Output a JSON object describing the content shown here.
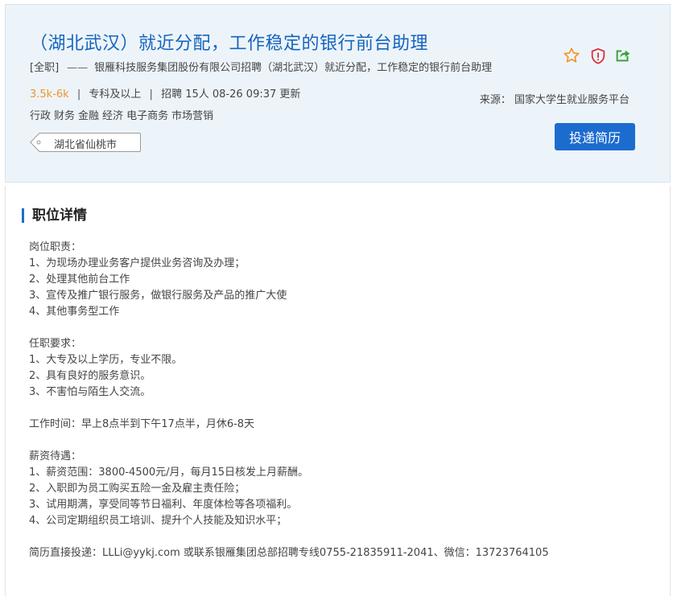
{
  "job": {
    "title": "（湖北武汉）就近分配，工作稳定的银行前台助理",
    "type_tag": "[全职]",
    "dash": "——",
    "company_line": "银雁科技服务集团股份有限公司招聘（湖北武汉）就近分配，工作稳定的银行前台助理",
    "salary": "3.5k-6k",
    "education": "专科及以上",
    "headcount": "招聘 15人",
    "updated": "08-26 09:37 更新",
    "sep": "|",
    "categories": [
      "行政",
      "财务",
      "金融",
      "经济",
      "电子商务",
      "市场营销"
    ],
    "location": "湖北省仙桃市",
    "source": "来源： 国家大学生就业服务平台",
    "apply_label": "投递简历"
  },
  "icons": {
    "favorite": "star-icon",
    "report": "shield-alert-icon",
    "share": "share-icon",
    "colors": {
      "star": "#f0952a",
      "shield": "#d9363e",
      "share": "#3aa33a",
      "accent": "#1c6ccf"
    }
  },
  "detail": {
    "section_title": "职位详情",
    "duties_title": "岗位职责：",
    "duties": [
      "1、为现场办理业务客户提供业务咨询及办理；",
      "2、处理其他前台工作",
      "3、宣传及推广银行服务，做银行服务及产品的推广大使",
      "4、其他事务型工作"
    ],
    "req_title": "任职要求：",
    "requirements": [
      "1、大专及以上学历，专业不限。",
      "2、具有良好的服务意识。",
      "3、不害怕与陌生人交流。"
    ],
    "work_time": "工作时间：早上8点半到下午17点半，月休6-8天",
    "benefits_title": "薪资待遇：",
    "benefits": [
      "1、薪资范围：3800-4500元/月，每月15日核发上月薪酬。",
      "2、入职即为员工购买五险一金及雇主责任险；",
      "3、试用期满，享受同等节日福利、年度体检等各项福利。",
      "4、公司定期组织员工培训、提升个人技能及知识水平；"
    ],
    "contact": "简历直接投递：LLLi@yykj.com  或联系银雁集团总部招聘专线0755-21835911-2041、微信：13723764105"
  }
}
